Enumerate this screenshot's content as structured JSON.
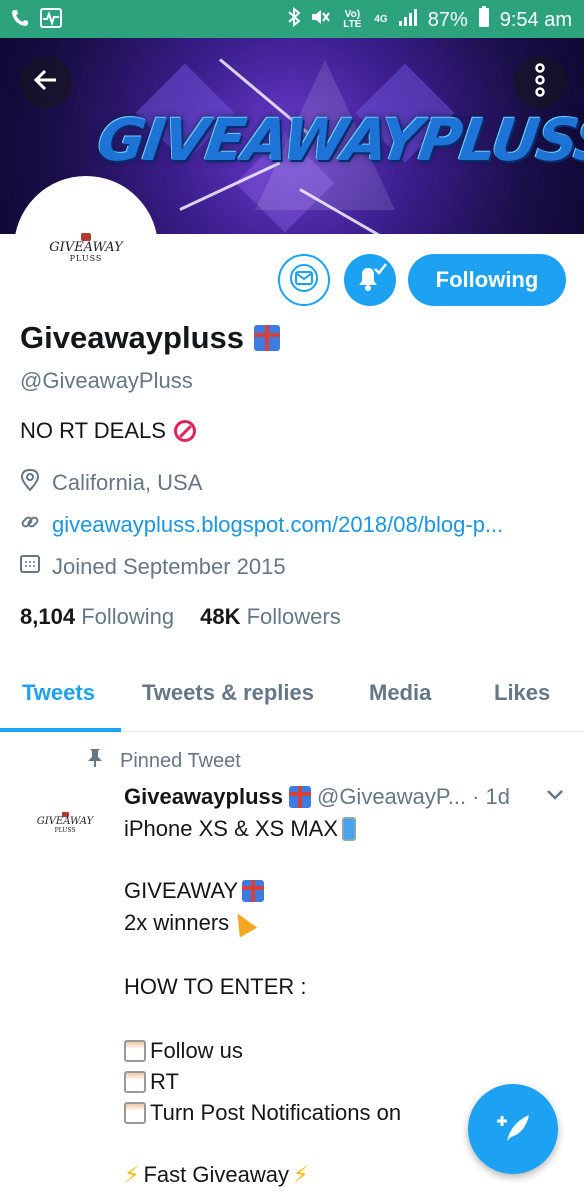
{
  "status_bar": {
    "battery_percent": "87%",
    "time": "9:54 am",
    "network": "4G",
    "volte": "Vo) LTE"
  },
  "banner": {
    "title": "GIVEAWAYPLUSS"
  },
  "avatar": {
    "logo_line1": "GIVEAWAY",
    "logo_line2": "PLUSS"
  },
  "actions": {
    "follow_label": "Following"
  },
  "profile": {
    "name": "Giveawaypluss",
    "handle": "@GiveawayPluss",
    "bio": "NO RT DEALS",
    "location": "California, USA",
    "url": "giveawaypluss.blogspot.com/2018/08/blog-p...",
    "joined": "Joined September 2015",
    "following_count": "8,104",
    "following_label": "Following",
    "followers_count": "48K",
    "followers_label": "Followers"
  },
  "tabs": [
    "Tweets",
    "Tweets & replies",
    "Media",
    "Likes"
  ],
  "tweet": {
    "pinned_label": "Pinned Tweet",
    "author_name": "Giveawaypluss",
    "author_handle": "@GiveawayP...",
    "time": "· 1d",
    "lines": {
      "l1": "iPhone XS & XS MAX",
      "l2": "GIVEAWAY",
      "l3": "2x winners",
      "l4": "HOW TO ENTER :",
      "l5": "Follow us",
      "l6": "RT",
      "l7": "Turn Post Notifications on",
      "l8": "Fast Giveaway"
    }
  },
  "colors": {
    "accent": "#1da1f2",
    "status_bar": "#2ca37c",
    "muted": "#657786",
    "text": "#14171a"
  }
}
